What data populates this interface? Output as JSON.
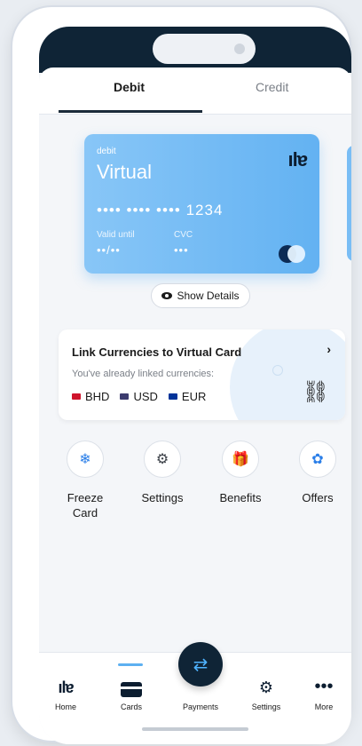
{
  "tabs": {
    "debit": "Debit",
    "credit": "Credit"
  },
  "card": {
    "type": "debit",
    "title": "Virtual",
    "logo": "ila",
    "number": "•••• •••• •••• 1234",
    "valid_label": "Valid until",
    "valid_value": "••/••",
    "cvc_label": "CVC",
    "cvc_value": "•••",
    "network_icon": "card-network-icon"
  },
  "show_details": {
    "label": "Show Details",
    "icon": "eye-icon"
  },
  "link_currencies": {
    "title": "Link Currencies to Virtual Card",
    "subtitle": "You've already linked currencies:",
    "currencies": [
      {
        "code": "BHD",
        "flag_color": "#cf142b"
      },
      {
        "code": "USD",
        "flag_color": "#3c3b6e"
      },
      {
        "code": "EUR",
        "flag_color": "#003399"
      }
    ],
    "icon": "link-chain-icon"
  },
  "actions": [
    {
      "label": "Freeze Card",
      "icon": "snowflake-icon"
    },
    {
      "label": "Settings",
      "icon": "gear-icon"
    },
    {
      "label": "Benefits",
      "icon": "gift-icon"
    },
    {
      "label": "Offers",
      "icon": "discount-badge-icon"
    }
  ],
  "bottom_nav": [
    {
      "label": "Home",
      "icon": "ila-logo-icon"
    },
    {
      "label": "Cards",
      "icon": "credit-card-icon"
    },
    {
      "label": "Payments",
      "icon": "transfer-arrows-icon"
    },
    {
      "label": "Settings",
      "icon": "gear-icon"
    },
    {
      "label": "More",
      "icon": "more-dots-icon"
    }
  ],
  "colors": {
    "brand_dark": "#0f2436",
    "card_gradient_start": "#88c6f7",
    "card_gradient_end": "#63b2f2",
    "accent_blue": "#2a7ee8",
    "active_indicator": "#5db0f1"
  }
}
